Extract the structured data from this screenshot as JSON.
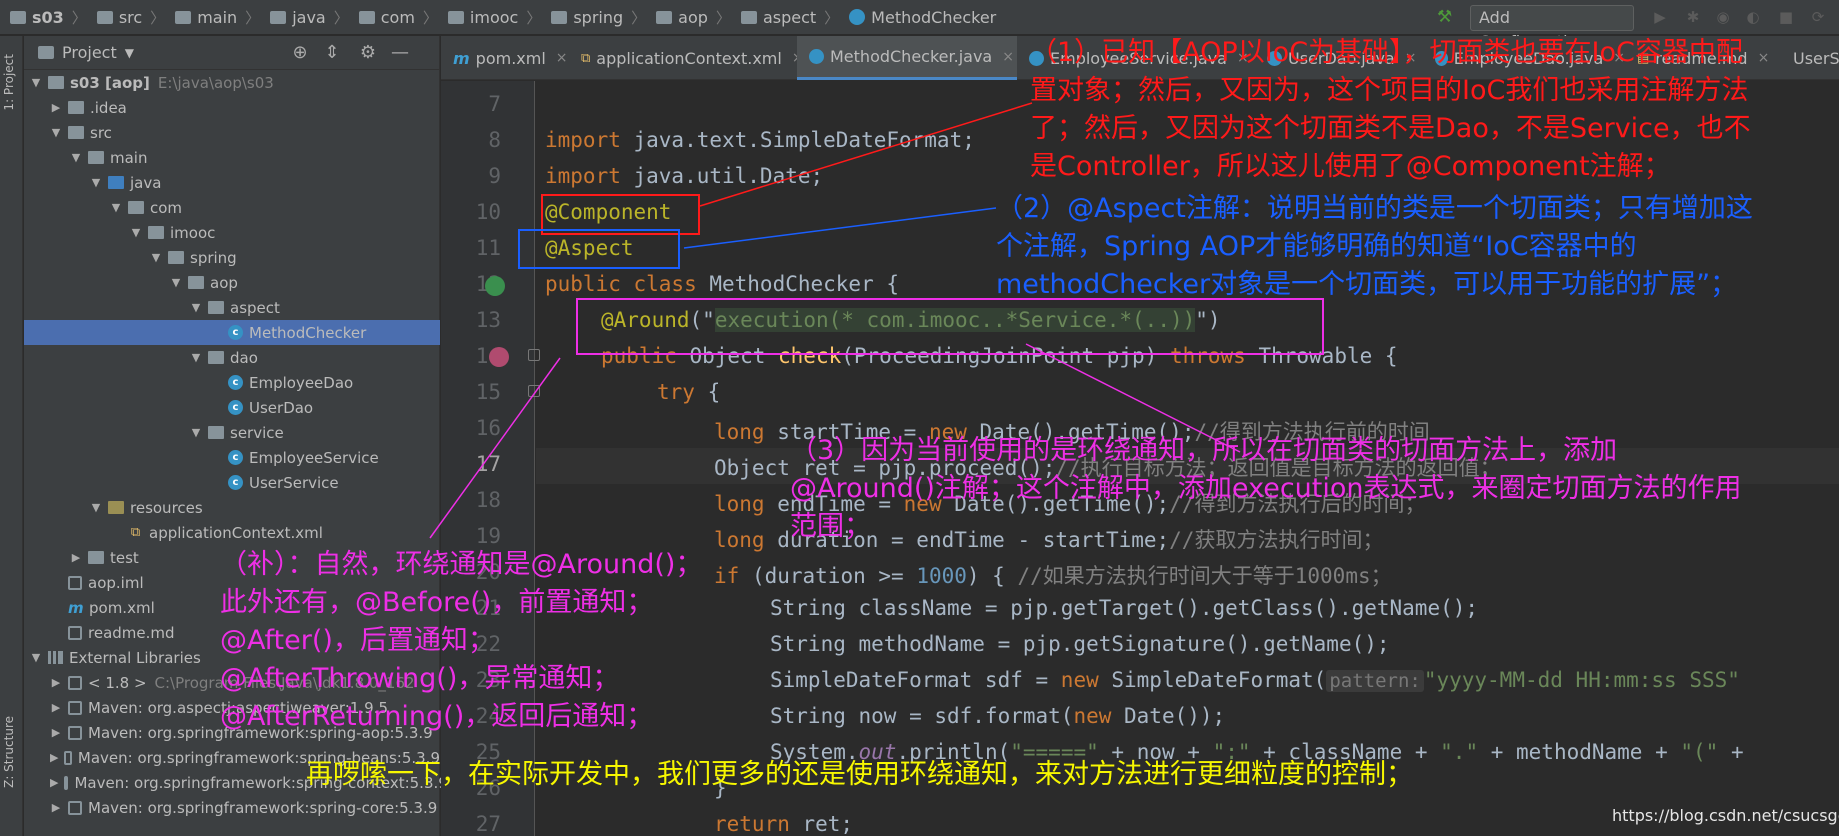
{
  "breadcrumb": [
    "s03",
    "src",
    "main",
    "java",
    "com",
    "imooc",
    "spring",
    "aop",
    "aspect",
    "MethodChecker"
  ],
  "toolbar": {
    "add_config": "Add Configuration..."
  },
  "side_tabs": {
    "project": "1: Project",
    "structure": "Z: Structure"
  },
  "project_panel": {
    "title": "Project",
    "tree": [
      {
        "label": "s03 [aop]",
        "extra": "E:\\java\\aop\\s03"
      },
      {
        "label": ".idea"
      },
      {
        "label": "src"
      },
      {
        "label": "main"
      },
      {
        "label": "java"
      },
      {
        "label": "com"
      },
      {
        "label": "imooc"
      },
      {
        "label": "spring"
      },
      {
        "label": "aop"
      },
      {
        "label": "aspect"
      },
      {
        "label": "MethodChecker"
      },
      {
        "label": "dao"
      },
      {
        "label": "EmployeeDao"
      },
      {
        "label": "UserDao"
      },
      {
        "label": "service"
      },
      {
        "label": "EmployeeService"
      },
      {
        "label": "UserService"
      },
      {
        "label": "resources"
      },
      {
        "label": "applicationContext.xml"
      },
      {
        "label": "test"
      },
      {
        "label": "aop.iml"
      },
      {
        "label": "pom.xml"
      },
      {
        "label": "readme.md"
      },
      {
        "label": "External Libraries"
      },
      {
        "label": "< 1.8 >",
        "extra": "C:\\Program Files\\Java\\jdk1.8.0_162"
      },
      {
        "label": "Maven: org.aspectj:aspectjweaver:1.9.5"
      },
      {
        "label": "Maven: org.springframework:spring-aop:5.3.9"
      },
      {
        "label": "Maven: org.springframework:spring-beans:5.3.9"
      },
      {
        "label": "Maven: org.springframework:spring-context:5.3.9"
      },
      {
        "label": "Maven: org.springframework:spring-core:5.3.9"
      }
    ]
  },
  "tabs": [
    "pom.xml",
    "applicationContext.xml",
    "MethodChecker.java",
    "EmployeeService.java",
    "UserDao.java",
    "EmployeeDao.java",
    "readme.md",
    "UserServ"
  ],
  "line_numbers": [
    "7",
    "8",
    "9",
    "10",
    "11",
    "12",
    "13",
    "14",
    "15",
    "16",
    "17",
    "18",
    "19",
    "20",
    "21",
    "22",
    "23",
    "24",
    "25",
    "26",
    "27"
  ],
  "code": {
    "l8_kw": "import",
    "l8_rest": " java.text.SimpleDateFormat;",
    "l9_kw": "import",
    "l9_rest": " java.util.Date;",
    "l10": "@Component",
    "l11": "@Aspect",
    "l12_kw": "public class",
    "l12_rest": " MethodChecker {",
    "l13_an": "@Around",
    "l13_p1": "(\"",
    "l13_str": "execution(* com.imooc..*Service.*(..))",
    "l13_p2": "\")",
    "l14_kw": "public",
    "l14_a": " Object ",
    "l14_fn": "check",
    "l14_b": "(ProceedingJoinPoint pjp) ",
    "l14_kw2": "throws",
    "l14_c": " Throwable {",
    "l15_kw": "try",
    "l15_rest": " {",
    "l16_kw": "long",
    "l16_a": " startTime = ",
    "l16_kw2": "new",
    "l16_b": " Date().getTime();",
    "l16_cm": "//得到方法执行前的时间",
    "l17_a": "Object ret = pjp.proceed();",
    "l17_cm": "//执行目标方法；返回值是目标方法的返回值；",
    "l18_kw": "long",
    "l18_a": " endTime = ",
    "l18_kw2": "new",
    "l18_b": " Date().getTime();",
    "l18_cm": "//得到方法执行后的时间；",
    "l19_kw": "long",
    "l19_a": " duration = endTime - startTime;",
    "l19_cm": "//获取方法执行时间；",
    "l20_kw": "if",
    "l20_a": " (duration >= ",
    "l20_nm": "1000",
    "l20_b": ") { ",
    "l20_cm": "//如果方法执行时间大于等于1000ms；",
    "l21": "String className = pjp.getTarget().getClass().getName();",
    "l22": "String methodName = pjp.getSignature().getName();",
    "l23_a": "SimpleDateFormat sdf = ",
    "l23_kw": "new",
    "l23_b": " SimpleDateFormat(",
    "l23_hint": "pattern:",
    "l23_str": "\"yyyy-MM-dd HH:mm:ss SSS\"",
    "l24_a": "String now = sdf.format(",
    "l24_kw": "new",
    "l24_b": " Date());",
    "l25_a": "System.",
    "l25_it": "out",
    "l25_b": ".println(",
    "l25_s1": "\"=====\"",
    "l25_c": " + now + ",
    "l25_s2": "\":\"",
    "l25_d": " + className + ",
    "l25_s3": "\".\"",
    "l25_e": " + methodName + ",
    "l25_s4": "\"(\"",
    "l25_f": " +",
    "l26": "}",
    "l27_kw": "return",
    "l27_rest": " ret;"
  },
  "annotations": {
    "note1": [
      "（1）已知【AOP以IoC为基础】，切面类也要在IoC容器中配",
      "置对象；然后，又因为，这个项目的IoC我们也采用注解方法",
      "了；然后，又因为这个切面类不是Dao，不是Service，也不",
      "是Controller，所以这儿使用了@Component注解；"
    ],
    "note2": [
      "（2）@Aspect注解：说明当前的类是一个切面类；只有增加这",
      "个注解，Spring AOP才能够明确的知道“IoC容器中的",
      "methodChecker对象是一个切面类，可以用于功能的扩展”；"
    ],
    "note3": [
      "（3）因为当前使用的是环绕通知，所以在切面类的切面方法上，添加",
      "@Around()注解；这个注解中，添加execution表达式，来圈定切面方法的作用",
      "范围；"
    ],
    "note4": [
      "（补）：自然，环绕通知是@Around()；",
      "此外还有，@Before()，前置通知；",
      "@After()，后置通知；",
      "@AfterThrowing()，异常通知；",
      "@AfterReturning()，返回后通知；"
    ],
    "note5": "再啰嗦一下，在实际开发中，我们更多的还是使用环绕通知，来对方法进行更细粒度的控制；"
  },
  "watermark": "https://blog.csdn.net/csucsgoat",
  "colors": {
    "red": "#ff1a1a",
    "blue": "#1a5fff",
    "magenta": "#ee2fe6",
    "yellow": "#f7f700"
  }
}
